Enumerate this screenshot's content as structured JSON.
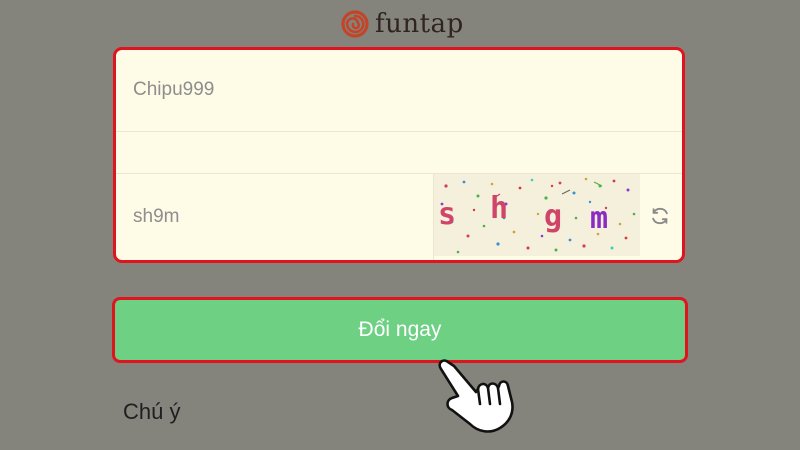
{
  "brand": {
    "name": "funtap",
    "logo_icon": "spiral-logo-icon"
  },
  "form": {
    "username_value": "Chipu999",
    "code_value": "",
    "captcha_input_value": "sh9m",
    "captcha_image_text": [
      "s",
      "h",
      "g",
      "m"
    ],
    "refresh_icon": "refresh-icon"
  },
  "actions": {
    "submit_label": "Đổi ngay"
  },
  "note": {
    "label": "Chú ý"
  },
  "colors": {
    "background": "#85847c",
    "form_background": "#fefbe7",
    "highlight_border": "#e0141e",
    "button_green": "#6dd083",
    "logo_orange": "#c2452a"
  },
  "overlay": {
    "cursor_icon": "hand-pointer-icon"
  }
}
